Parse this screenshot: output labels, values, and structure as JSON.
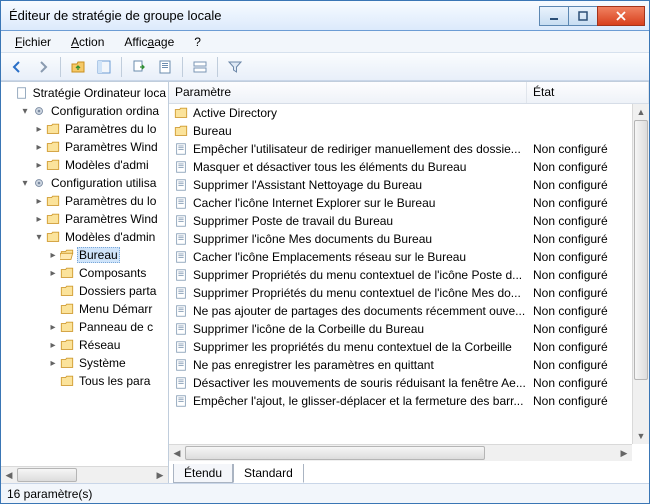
{
  "window": {
    "title": "Éditeur de stratégie de groupe locale"
  },
  "menu": {
    "file": "Fichier",
    "action": "Action",
    "view": "Affichage",
    "help": "?"
  },
  "tree": {
    "root": "Stratégie Ordinateur loca",
    "computer": "Configuration ordina",
    "computer_children": [
      "Paramètres du lo",
      "Paramètres Wind",
      "Modèles d'admi"
    ],
    "user": "Configuration utilisa",
    "user_children": [
      "Paramètres du lo",
      "Paramètres Wind"
    ],
    "admin": "Modèles d'admin",
    "admin_children": [
      "Bureau",
      "Composants",
      "Dossiers parta",
      "Menu Démarr",
      "Panneau de c",
      "Réseau",
      "Système",
      "Tous les para"
    ],
    "selected": "Bureau"
  },
  "columns": {
    "param": "Paramètre",
    "etat": "État"
  },
  "rows": [
    {
      "type": "folder",
      "param": "Active Directory",
      "etat": ""
    },
    {
      "type": "folder",
      "param": "Bureau",
      "etat": ""
    },
    {
      "type": "setting",
      "param": "Empêcher l'utilisateur de rediriger manuellement des dossie...",
      "etat": "Non configuré"
    },
    {
      "type": "setting",
      "param": "Masquer et désactiver tous les éléments du Bureau",
      "etat": "Non configuré"
    },
    {
      "type": "setting",
      "param": "Supprimer l'Assistant Nettoyage du Bureau",
      "etat": "Non configuré"
    },
    {
      "type": "setting",
      "param": "Cacher l'icône Internet Explorer sur le Bureau",
      "etat": "Non configuré"
    },
    {
      "type": "setting",
      "param": "Supprimer Poste de travail du Bureau",
      "etat": "Non configuré"
    },
    {
      "type": "setting",
      "param": "Supprimer l'icône Mes documents du Bureau",
      "etat": "Non configuré"
    },
    {
      "type": "setting",
      "param": "Cacher l'icône Emplacements réseau sur le Bureau",
      "etat": "Non configuré"
    },
    {
      "type": "setting",
      "param": "Supprimer Propriétés du menu contextuel de l'icône Poste d...",
      "etat": "Non configuré"
    },
    {
      "type": "setting",
      "param": "Supprimer Propriétés du menu contextuel de l'icône Mes do...",
      "etat": "Non configuré"
    },
    {
      "type": "setting",
      "param": "Ne pas ajouter de partages des documents récemment ouve...",
      "etat": "Non configuré"
    },
    {
      "type": "setting",
      "param": "Supprimer l'icône de la Corbeille du Bureau",
      "etat": "Non configuré"
    },
    {
      "type": "setting",
      "param": "Supprimer les propriétés du menu contextuel de la Corbeille",
      "etat": "Non configuré"
    },
    {
      "type": "setting",
      "param": "Ne pas enregistrer les paramètres en quittant",
      "etat": "Non configuré"
    },
    {
      "type": "setting",
      "param": "Désactiver les mouvements de souris réduisant la fenêtre Ae...",
      "etat": "Non configuré"
    },
    {
      "type": "setting",
      "param": "Empêcher l'ajout, le glisser-déplacer et la fermeture des barr...",
      "etat": "Non configuré"
    }
  ],
  "tabs": {
    "extended": "Étendu",
    "standard": "Standard"
  },
  "status": "16 paramètre(s)"
}
